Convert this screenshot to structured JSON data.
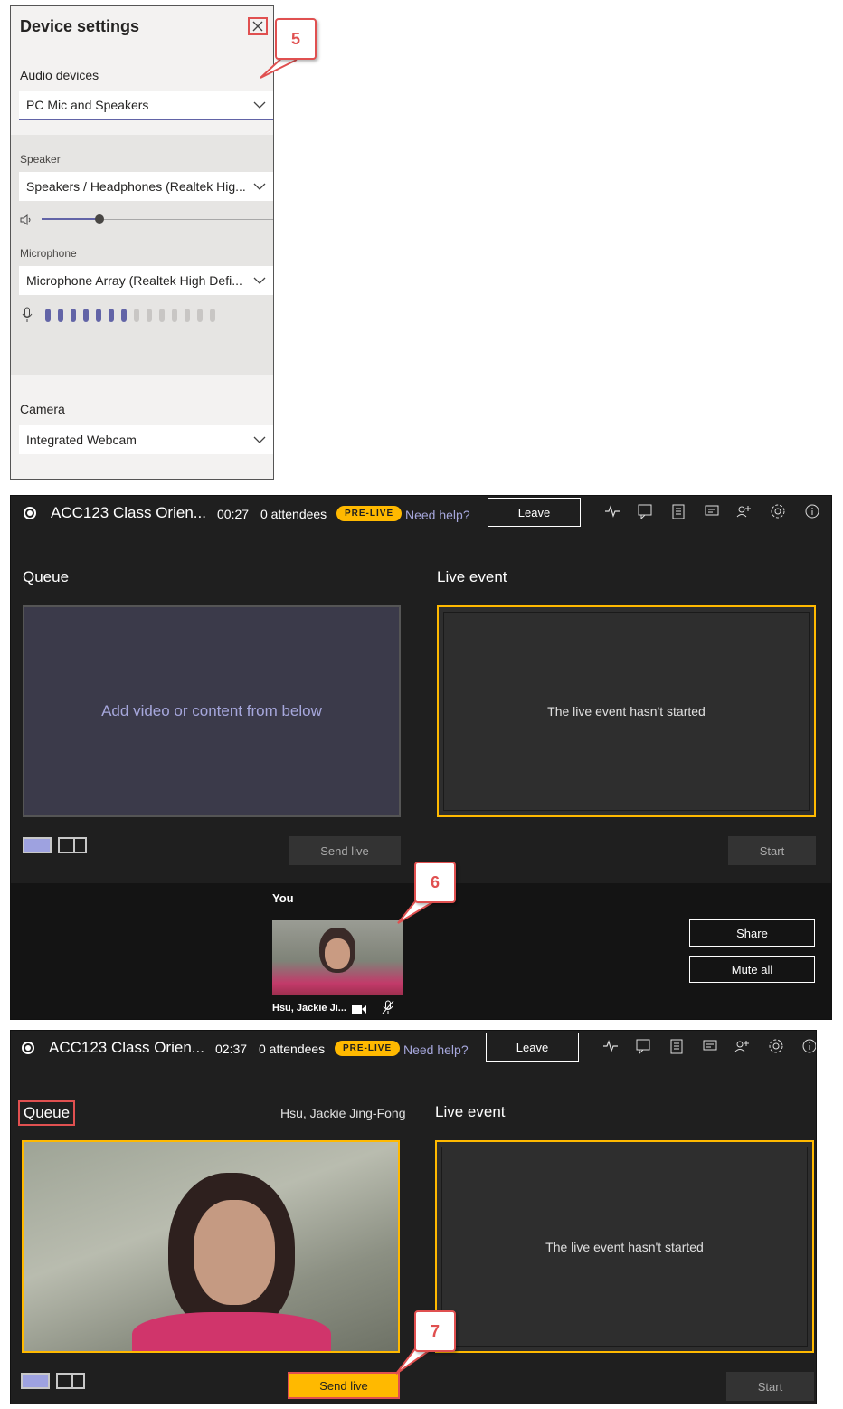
{
  "device_settings": {
    "title": "Device settings",
    "audio_label": "Audio devices",
    "audio_value": "PC Mic and Speakers",
    "speaker_label": "Speaker",
    "speaker_value": "Speakers / Headphones (Realtek Hig...",
    "speaker_volume": 0.25,
    "microphone_label": "Microphone",
    "microphone_value": "Microphone Array (Realtek High Defi...",
    "mic_level_active": 7,
    "mic_level_total": 14,
    "camera_label": "Camera",
    "camera_value": "Integrated Webcam"
  },
  "callouts": {
    "c5": "5",
    "c6": "6",
    "c7": "7"
  },
  "screen1": {
    "event_title": "ACC123 Class Orien...",
    "timer": "00:27",
    "attendees": "0 attendees",
    "badge": "PRE-LIVE",
    "help": "Need help?",
    "leave": "Leave",
    "queue_title": "Queue",
    "queue_placeholder": "Add video or content from below",
    "live_title": "Live event",
    "live_status": "The live event hasn't started",
    "send_live": "Send live",
    "start": "Start",
    "you_label": "You",
    "participant_name": "Hsu, Jackie Ji...",
    "share": "Share",
    "mute_all": "Mute all"
  },
  "screen2": {
    "event_title": "ACC123 Class Orien...",
    "timer": "02:37",
    "attendees": "0 attendees",
    "badge": "PRE-LIVE",
    "help": "Need help?",
    "leave": "Leave",
    "queue_title": "Queue",
    "queue_person": "Hsu, Jackie Jing-Fong",
    "live_title": "Live event",
    "live_status": "The live event hasn't started",
    "send_live": "Send live",
    "start": "Start"
  },
  "colors": {
    "accent": "#6264a7",
    "prelive": "#ffb900",
    "callout": "#e05050",
    "dark_bg": "#1f1f1f"
  }
}
